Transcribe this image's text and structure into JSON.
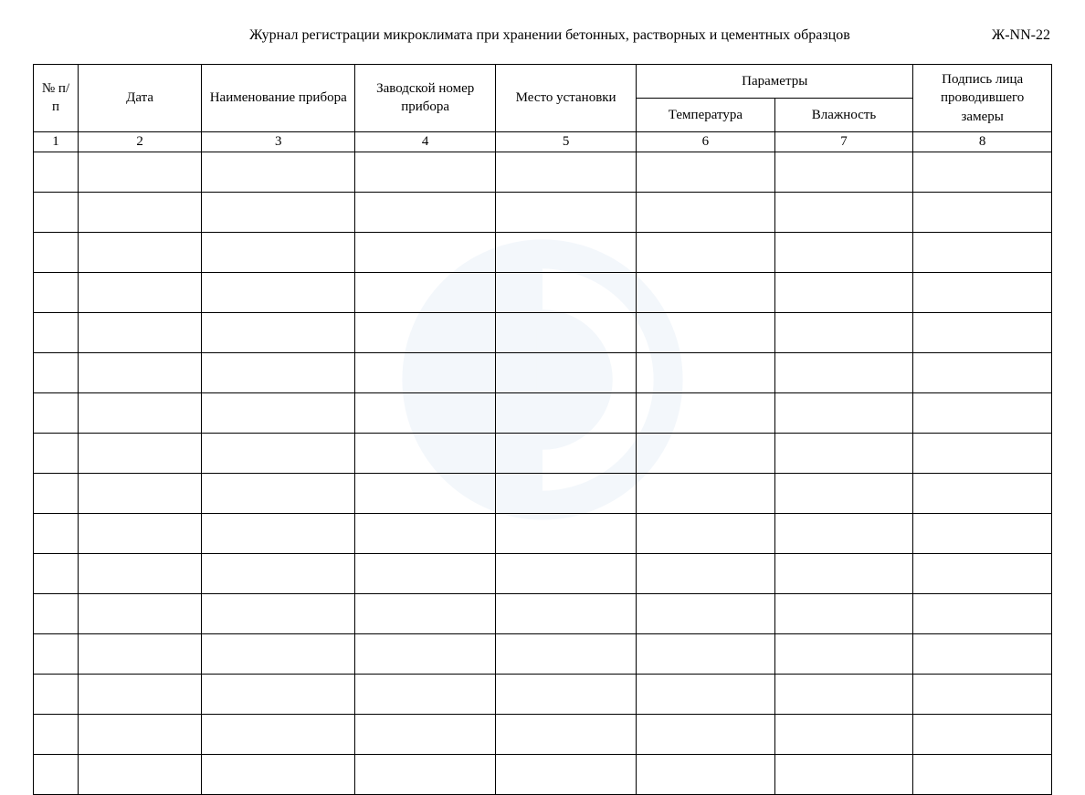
{
  "header": {
    "title": "Журнал регистрации микроклимата при хранении бетонных, растворных и цементных образцов",
    "doc_code": "Ж-NN-22"
  },
  "table": {
    "headers": {
      "col1": "№ п/п",
      "col2": "Дата",
      "col3": "Наименование прибора",
      "col4": "Заводской номер прибора",
      "col5": "Место установки",
      "params_group": "Параметры",
      "col6": "Температура",
      "col7": "Влажность",
      "col8": "Подпись лица проводившего замеры"
    },
    "column_numbers": [
      "1",
      "2",
      "3",
      "4",
      "5",
      "6",
      "7",
      "8"
    ],
    "row_count": 16
  }
}
